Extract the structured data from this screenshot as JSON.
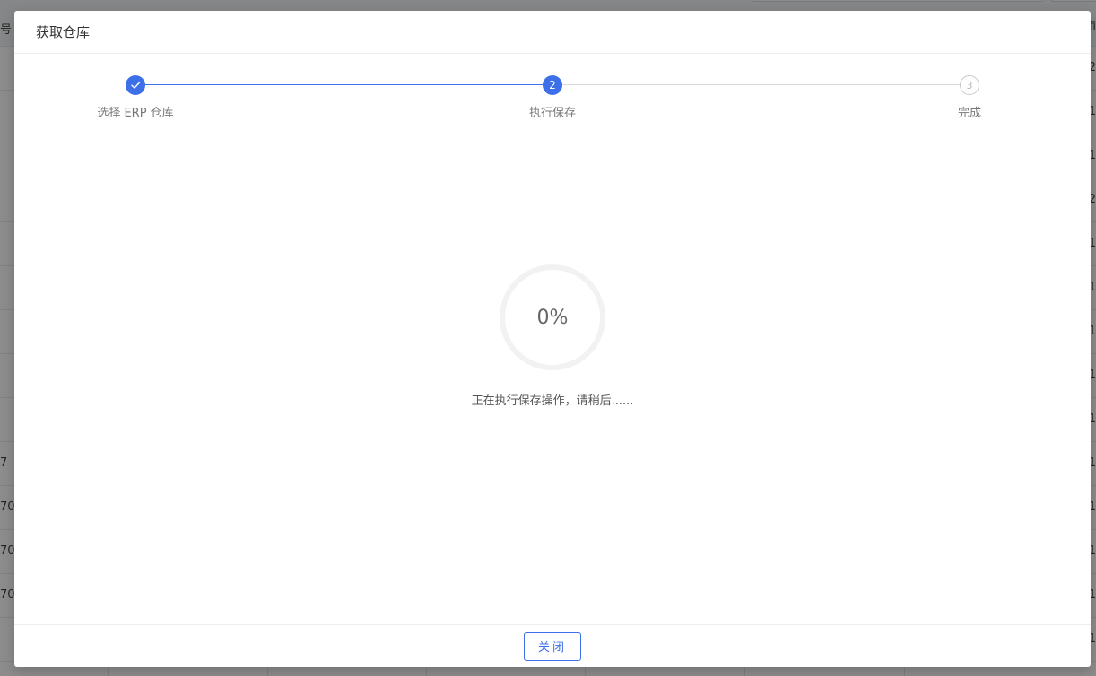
{
  "background": {
    "header_left": "号",
    "header_right": "fi",
    "rows": [
      {
        "left": "",
        "right": "2"
      },
      {
        "left": "",
        "right": "1"
      },
      {
        "left": "",
        "right": "1"
      },
      {
        "left": "",
        "right": "2"
      },
      {
        "left": "",
        "right": "1"
      },
      {
        "left": "",
        "right": "1"
      },
      {
        "left": "",
        "right": "1"
      },
      {
        "left": "",
        "right": "1"
      },
      {
        "left": "",
        "right": "1"
      },
      {
        "left": "7",
        "right": "1"
      },
      {
        "left": "70",
        "right": "1"
      },
      {
        "left": "70",
        "right": "1"
      },
      {
        "left": "70",
        "right": "1"
      },
      {
        "left": "",
        "right": "1"
      }
    ]
  },
  "modal": {
    "title": "获取仓库",
    "steps": [
      {
        "label": "选择 ERP 仓库",
        "state": "done",
        "number": "1",
        "icon": "check-icon"
      },
      {
        "label": "执行保存",
        "state": "active",
        "number": "2"
      },
      {
        "label": "完成",
        "state": "pending",
        "number": "3"
      }
    ],
    "progress": {
      "percent": 0,
      "text": "0%",
      "status": "正在执行保存操作，请稍后......"
    },
    "footer": {
      "close_label": "关闭"
    }
  },
  "colors": {
    "primary": "#3d6fe8",
    "track": "#f2f2f2",
    "pending": "#c8c8c8"
  }
}
